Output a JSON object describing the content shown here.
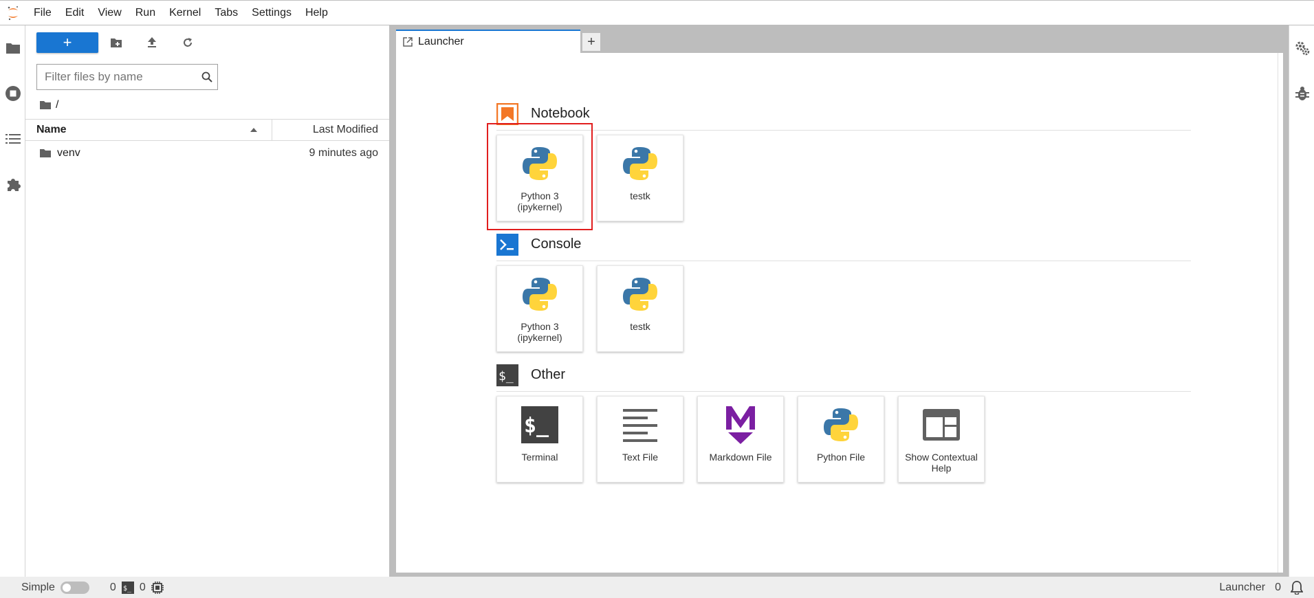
{
  "menubar": {
    "items": [
      "File",
      "Edit",
      "View",
      "Run",
      "Kernel",
      "Tabs",
      "Settings",
      "Help"
    ]
  },
  "filebrowser": {
    "new_button_label": "+",
    "filter_placeholder": "Filter files by name",
    "breadcrumb": "/",
    "columns": {
      "name": "Name",
      "modified": "Last Modified"
    },
    "sort_column": "Name",
    "sort_direction": "ascending",
    "files": [
      {
        "name": "venv",
        "modified": "9 minutes ago",
        "type": "folder"
      }
    ]
  },
  "tabs": {
    "active_label": "Launcher",
    "add_label": "+"
  },
  "launcher": {
    "sections": {
      "notebook": "Notebook",
      "console": "Console",
      "other": "Other"
    },
    "notebook_cards": [
      {
        "label": "Python 3 (ipykernel)",
        "icon": "python-icon"
      },
      {
        "label": "testk",
        "icon": "python-icon"
      }
    ],
    "console_cards": [
      {
        "label": "Python 3 (ipykernel)",
        "icon": "python-icon"
      },
      {
        "label": "testk",
        "icon": "python-icon"
      }
    ],
    "other_cards": [
      {
        "label": "Terminal",
        "icon": "terminal-icon"
      },
      {
        "label": "Text File",
        "icon": "text-file-icon"
      },
      {
        "label": "Markdown File",
        "icon": "markdown-icon"
      },
      {
        "label": "Python File",
        "icon": "python-icon"
      },
      {
        "label": "Show Contextual Help",
        "icon": "contextual-help-icon"
      }
    ]
  },
  "statusbar": {
    "simple_label": "Simple",
    "simple_enabled": false,
    "kernels_count": "0",
    "terminals_count": "0",
    "right_label": "Launcher",
    "notifications_count": "0"
  },
  "colors": {
    "accent": "#1976d2",
    "highlight": "#e11d1d",
    "notebook_icon": "#f37726",
    "markdown_icon": "#7b1fa2",
    "python_blue": "#3b77a8",
    "python_yellow": "#ffd43b"
  }
}
